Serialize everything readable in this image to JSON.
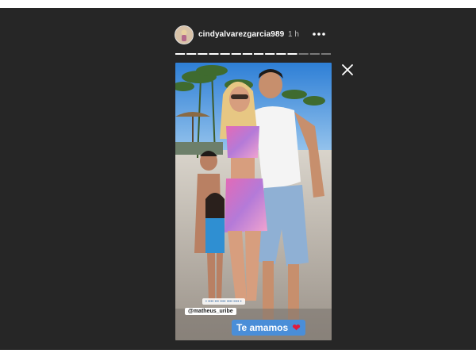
{
  "story": {
    "username": "cindyalvarezgarcia989",
    "time_ago": "1 h",
    "segments_total": 14,
    "segments_viewed": 11,
    "mention_tag": "@matheus_uribe",
    "sticker_text": "Te amamos",
    "sticker_emoji": "❤"
  },
  "icons": {
    "more": "more-options-icon",
    "close": "close-icon",
    "heart": "heart-icon"
  },
  "colors": {
    "viewer_bg": "#262626",
    "sticker_bg": "#4a8ed8",
    "heart": "#e21b3c"
  }
}
